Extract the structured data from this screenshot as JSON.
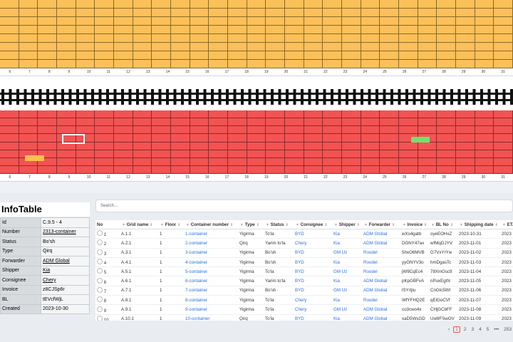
{
  "top_bay": {
    "numbers": [
      "6",
      "7",
      "8",
      "9",
      "10",
      "11",
      "12",
      "13",
      "14",
      "15",
      "16",
      "17",
      "18",
      "19",
      "20",
      "21",
      "22",
      "23",
      "24",
      "25",
      "26",
      "27",
      "28",
      "29",
      "30",
      "31"
    ]
  },
  "bottom_bay": {
    "numbers": [
      "6",
      "7",
      "8",
      "9",
      "10",
      "11",
      "12",
      "13",
      "14",
      "15",
      "16",
      "17",
      "18",
      "19",
      "20",
      "21",
      "22",
      "23",
      "24",
      "25",
      "26",
      "27",
      "28",
      "29",
      "30",
      "31"
    ]
  },
  "colors": {
    "occupied": "#fcc05a",
    "free": "#f25353",
    "selected_outline": "#ffffff",
    "highlight_green": "#6fe26b",
    "highlight_yellow": "#fbc04f"
  },
  "info_panel": {
    "title": "InfoTable",
    "rows": [
      {
        "key": "Id",
        "value": "C.9.5 - 4",
        "link": false
      },
      {
        "key": "Number",
        "value": "2313-container",
        "link": true
      },
      {
        "key": "Status",
        "value": "Bo'sh",
        "link": false
      },
      {
        "key": "Type",
        "value": "Qirq",
        "link": false
      },
      {
        "key": "Forwarder",
        "value": "ADM Global",
        "link": true
      },
      {
        "key": "Shipper",
        "value": "Kia",
        "link": true
      },
      {
        "key": "Consignee",
        "value": "Chery",
        "link": true
      },
      {
        "key": "Invoice",
        "value": "z8CJSp6r",
        "link": false
      },
      {
        "key": "BL",
        "value": "tEVcfWjL",
        "link": false
      },
      {
        "key": "Created",
        "value": "2023-10-30",
        "link": false
      }
    ]
  },
  "search": {
    "placeholder": "Search..."
  },
  "table": {
    "headers": [
      "No",
      "Grid name",
      "Floor",
      "Container number",
      "Type",
      "Status",
      "Consignee",
      "Shipper",
      "Forwarder",
      "Invoice",
      "BL No",
      "Shipping date",
      "ETA"
    ],
    "rows": [
      [
        "1",
        "A.1.1",
        "1",
        "1-container",
        "Yigirma",
        "To'la",
        "BYD",
        "Kia",
        "ADM Global",
        "wXs4gatb",
        "oyeEOHxZ",
        "2023-10-31",
        "2023"
      ],
      [
        "2",
        "A.2.1",
        "1",
        "2-container",
        "Qirq",
        "Yarim to'la",
        "Chery",
        "Kia",
        "ADM Global",
        "DGNY47ax",
        "wfMqGJYV",
        "2023-11-01",
        "2023"
      ],
      [
        "3",
        "A.3.1",
        "1",
        "3-container",
        "Yigirma",
        "Bo'sh",
        "BYD",
        "GM Uz",
        "Roodel",
        "5hxO6MVB",
        "G7VxYrYw",
        "2023-11-02",
        "2023"
      ],
      [
        "4",
        "A.4.1",
        "1",
        "4-container",
        "Yigirma",
        "Bo'sh",
        "BYD",
        "Kia",
        "Roodel",
        "yyGNYV3o",
        "hmDgasTc",
        "2023-11-03",
        "2023"
      ],
      [
        "5",
        "A.5.1",
        "1",
        "5-container",
        "Yigirma",
        "To'la",
        "BYD",
        "GM Uz",
        "Roodel",
        "jW9CqEc4",
        "78XmGsc9",
        "2023-11-04",
        "2023"
      ],
      [
        "6",
        "A.6.1",
        "1",
        "6-container",
        "Yigirma",
        "Yarim to'la",
        "BYD",
        "Kia",
        "ADM Global",
        "pKpGBFvA",
        "nPuxEgIN",
        "2023-11-05",
        "2023"
      ],
      [
        "7",
        "A.7.1",
        "1",
        "7-container",
        "Yigirma",
        "Bo'sh",
        "BYD",
        "GM Uz",
        "ADM Global",
        "lSYrljiu",
        "CnGlc5WI",
        "2023-11-06",
        "2023"
      ],
      [
        "8",
        "A.8.1",
        "1",
        "8-container",
        "Yigirma",
        "To'la",
        "Chery",
        "Kia",
        "Roodel",
        "WfYFHQ2E",
        "qElGoCVf",
        "2023-11-07",
        "2023"
      ],
      [
        "9",
        "A.9.1",
        "1",
        "9-container",
        "Yigirma",
        "To'la",
        "Chery",
        "GM Uz",
        "ADM Global",
        "co3cwo4x",
        "CHjGCbFF",
        "2023-11-08",
        "2023"
      ],
      [
        "10",
        "A.10.1",
        "1",
        "10-container",
        "Qirq",
        "To'la",
        "BYD",
        "Kia",
        "ADM Global",
        "xaD5WsGD",
        "Uw9FSwOV",
        "2023-11-09",
        "2023"
      ]
    ]
  },
  "pager": {
    "pages": [
      "1",
      "2",
      "3",
      "4",
      "5",
      "•••",
      "253"
    ],
    "prev": "‹"
  }
}
